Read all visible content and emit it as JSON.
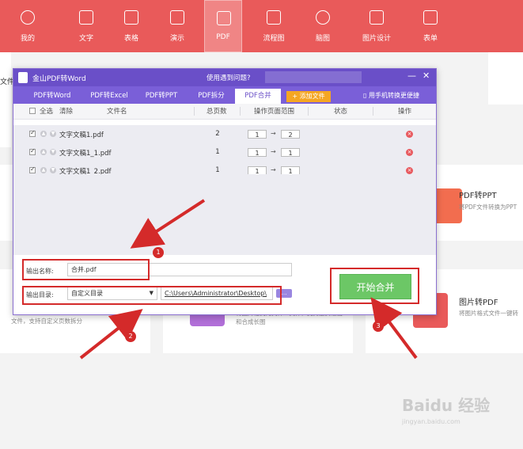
{
  "topbar": {
    "items": [
      {
        "label": "我的",
        "icon": "star-icon"
      },
      {
        "label": "文字",
        "icon": "document-icon"
      },
      {
        "label": "表格",
        "icon": "table-icon"
      },
      {
        "label": "演示",
        "icon": "presentation-icon"
      },
      {
        "label": "PDF",
        "icon": "pdf-icon"
      },
      {
        "label": "流程图",
        "icon": "flowchart-icon"
      },
      {
        "label": "脑图",
        "icon": "mindmap-icon"
      },
      {
        "label": "图片设计",
        "icon": "image-design-icon"
      },
      {
        "label": "表单",
        "icon": "form-icon"
      }
    ],
    "active": "PDF"
  },
  "background": {
    "left_partial": "文件",
    "cards": [
      {
        "title": "PDF转PPT",
        "desc": "将PDF文件转换为PPT"
      },
      {
        "title": "图片转PDF",
        "desc": "将图片格式文件一键转"
      },
      {
        "desc": "文件，支持自定义页数拆分"
      },
      {
        "desc": "将图片格式的文件一文件，支持逐页输出和合成长图"
      }
    ]
  },
  "dialog": {
    "title": "金山PDF转Word",
    "help": "使用遇到问题?",
    "tabs": [
      "PDF转Word",
      "PDF转Excel",
      "PDF转PPT",
      "PDF拆分",
      "PDF合并"
    ],
    "active_tab": "PDF合并",
    "add_file": "+ 添加文件",
    "phone": "用手机转换更便捷",
    "columns": {
      "select_all": "全选",
      "clear": "清除",
      "filename": "文件名",
      "pages": "总页数",
      "range": "操作页面范围",
      "status": "状态",
      "action": "操作"
    },
    "files": [
      {
        "name": "文字文稿1.pdf",
        "pages": "2",
        "from": "1",
        "to": "2"
      },
      {
        "name": "文字文稿1_1.pdf",
        "pages": "1",
        "from": "1",
        "to": "1"
      },
      {
        "name": "文字文稿1_2.pdf",
        "pages": "1",
        "from": "1",
        "to": "1"
      }
    ],
    "output_name_label": "输出名称:",
    "output_name": "合并.pdf",
    "output_dir_label": "输出目录:",
    "output_dir_option": "自定义目录",
    "output_path": "C:\\Users\\Administrator\\Desktop\\",
    "start": "开始合并"
  },
  "annotations": [
    "1",
    "2",
    "3"
  ],
  "watermark": "Baidu 经验",
  "watermark_url": "jingyan.baidu.com"
}
